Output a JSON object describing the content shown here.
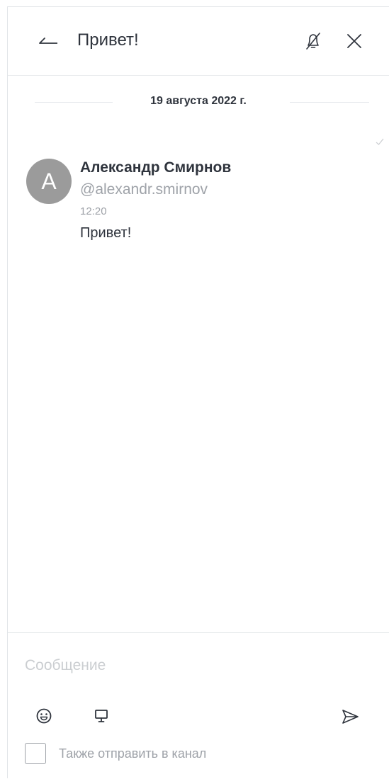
{
  "header": {
    "title": "Привет!",
    "back_icon": "arrow-back-icon",
    "mute_icon": "bell-off-icon",
    "close_icon": "close-icon"
  },
  "date_divider": "19 августа 2022 г.",
  "message": {
    "avatar_letter": "A",
    "author": "Александр Смирнов",
    "username": "@alexandr.smirnov",
    "time": "12:20",
    "text": "Привет!",
    "read_icon": "check-icon"
  },
  "composer": {
    "placeholder": "Сообщение",
    "value": "",
    "emoji_icon": "emoji-icon",
    "screen_icon": "monitor-icon",
    "send_icon": "send-icon",
    "also_send_label": "Также отправить в канал",
    "also_send_checked": false
  },
  "colors": {
    "primary_text": "#2f343d",
    "secondary_text": "#9ea2a8",
    "placeholder": "#cbced1",
    "avatar_bg": "#9b9b9b",
    "divider": "#e1e5e8"
  }
}
